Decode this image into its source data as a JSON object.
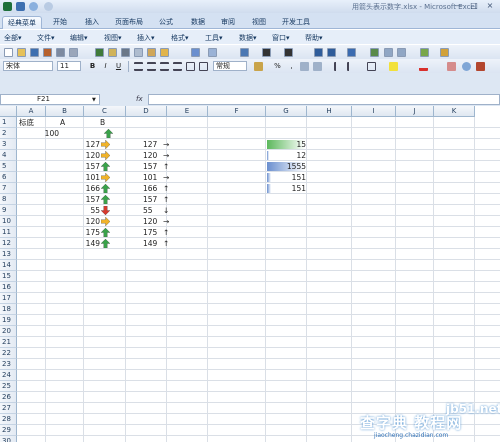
{
  "window": {
    "title": "用箭头表示数字.xlsx - Microsoft Excel",
    "controls": [
      "—",
      "□",
      "×"
    ]
  },
  "ribbon_tabs": [
    {
      "label": "经典菜单",
      "active": true
    },
    {
      "label": "开始",
      "active": false
    },
    {
      "label": "插入",
      "active": false
    },
    {
      "label": "页面布局",
      "active": false
    },
    {
      "label": "公式",
      "active": false
    },
    {
      "label": "数据",
      "active": false
    },
    {
      "label": "审阅",
      "active": false
    },
    {
      "label": "视图",
      "active": false
    },
    {
      "label": "开发工具",
      "active": false
    }
  ],
  "menus": [
    "全部▾",
    "文件▾",
    "编辑▾",
    "视图▾",
    "插入▾",
    "格式▾",
    "工具▾",
    "数据▾",
    "窗口▾",
    "帮助▾"
  ],
  "toolbar": {
    "font_name": "宋体",
    "font_size": "11",
    "bold": "B",
    "italic": "I",
    "underline": "U",
    "number_format": "常规",
    "percent": "%",
    "comma": ","
  },
  "formula_bar": {
    "name_box": "F21",
    "fx_label": "fx",
    "formula": ""
  },
  "columns": [
    "A",
    "B",
    "C",
    "D",
    "E",
    "F",
    "G",
    "H",
    "I",
    "J",
    "K"
  ],
  "rows": [
    "1",
    "2",
    "3",
    "4",
    "5",
    "6",
    "7",
    "8",
    "9",
    "10",
    "11",
    "12",
    "13",
    "14",
    "15",
    "16",
    "17",
    "18",
    "19",
    "20",
    "21",
    "22",
    "23",
    "24",
    "25",
    "26",
    "27",
    "28",
    "29",
    "30"
  ],
  "cells": {
    "A1": "标底",
    "B1": "A",
    "C1": "B",
    "A2": "100"
  },
  "col_b": [
    "127",
    "120",
    "157",
    "101",
    "166",
    "157",
    "55",
    "120",
    "175",
    "149"
  ],
  "col_c_icons": [
    "up-green",
    "right-yellow",
    "right-yellow",
    "up-green",
    "right-yellow",
    "up-green",
    "up-green",
    "down-red",
    "right-yellow",
    "up-green",
    "up-green"
  ],
  "col_d": [
    {
      "value": "127",
      "arrow": "→"
    },
    {
      "value": "120",
      "arrow": "→"
    },
    {
      "value": "157",
      "arrow": "↑"
    },
    {
      "value": "101",
      "arrow": "→"
    },
    {
      "value": "166",
      "arrow": "↑"
    },
    {
      "value": "157",
      "arrow": "↑"
    },
    {
      "value": "55",
      "arrow": "↓"
    },
    {
      "value": "120",
      "arrow": "→"
    },
    {
      "value": "175",
      "arrow": "↑"
    },
    {
      "value": "149",
      "arrow": "↑"
    }
  ],
  "col_g": [
    {
      "value": "15",
      "bar_fraction": 1.0,
      "color": "#5cb85c"
    },
    {
      "value": "12",
      "bar_fraction": 0.02,
      "color": "#6a8fcf"
    },
    {
      "value": "1555",
      "bar_fraction": 1.0,
      "color": "#6a8fcf"
    },
    {
      "value": "151",
      "bar_fraction": 0.11,
      "color": "#6a8fcf"
    },
    {
      "value": "151",
      "bar_fraction": 0.11,
      "color": "#6a8fcf"
    }
  ],
  "watermark": {
    "line1": "查字典 教程网",
    "line2": "jb51.net",
    "line3": "jiaocheng.chazidian.com"
  }
}
